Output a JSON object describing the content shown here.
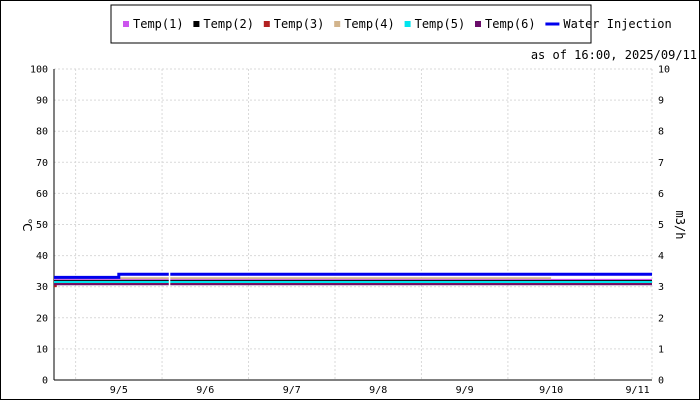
{
  "timestamp": "as of 16:00, 2025/09/11",
  "chart_data": {
    "type": "line",
    "x_ticks": [
      "9/5",
      "9/6",
      "9/7",
      "9/8",
      "9/9",
      "9/10",
      "9/11"
    ],
    "x_range": [
      "2025-09-04 18:00",
      "2025-09-11 16:00"
    ],
    "y_left": {
      "label": "℃",
      "min": 0,
      "max": 100,
      "ticks": [
        0,
        10,
        20,
        30,
        40,
        50,
        60,
        70,
        80,
        90,
        100
      ]
    },
    "y_right": {
      "label": "m3/h",
      "min": 0,
      "max": 10,
      "ticks": [
        0,
        1,
        2,
        3,
        4,
        5,
        6,
        7,
        8,
        9,
        10
      ]
    },
    "grid": true,
    "legend_position": "top-center",
    "series": [
      {
        "name": "Temp(1)",
        "color": "#cc55ee",
        "axis": "left",
        "x": [
          "2025-09-04 18:00",
          "2025-09-11 16:00"
        ],
        "y": [
          32.2,
          32.2
        ]
      },
      {
        "name": "Temp(2)",
        "color": "#000000",
        "axis": "left",
        "x": [
          "2025-09-04 18:00",
          "2025-09-11 16:00"
        ],
        "y": [
          31.8,
          31.8
        ]
      },
      {
        "name": "Temp(3)",
        "color": "#b22222",
        "axis": "left",
        "x": [
          "2025-09-04 18:00",
          "2025-09-04 18:30",
          "2025-09-04 18:30",
          "2025-09-11 16:00"
        ],
        "y": [
          30.2,
          30.2,
          31.1,
          31.1
        ]
      },
      {
        "name": "Temp(4)",
        "color": "#d2b48c",
        "axis": "left",
        "x": [
          "2025-09-04 18:00",
          "2025-09-10 12:00"
        ],
        "y": [
          32.7,
          32.7
        ]
      },
      {
        "name": "Temp(5)",
        "color": "#00e5ee",
        "axis": "left",
        "x": [
          "2025-09-04 18:00",
          "2025-09-11 16:00"
        ],
        "y": [
          31.5,
          31.5
        ]
      },
      {
        "name": "Temp(6)",
        "color": "#6a0d6a",
        "axis": "left",
        "x": [
          "2025-09-04 18:00",
          "2025-09-11 16:00"
        ],
        "y": [
          30.8,
          30.8
        ]
      },
      {
        "name": "Water Injection",
        "color": "#0000ee",
        "axis": "right",
        "x": [
          "2025-09-04 18:00",
          "2025-09-05 12:00",
          "2025-09-05 12:00",
          "2025-09-11 16:00"
        ],
        "y": [
          3.3,
          3.3,
          3.4,
          3.4
        ]
      }
    ]
  }
}
